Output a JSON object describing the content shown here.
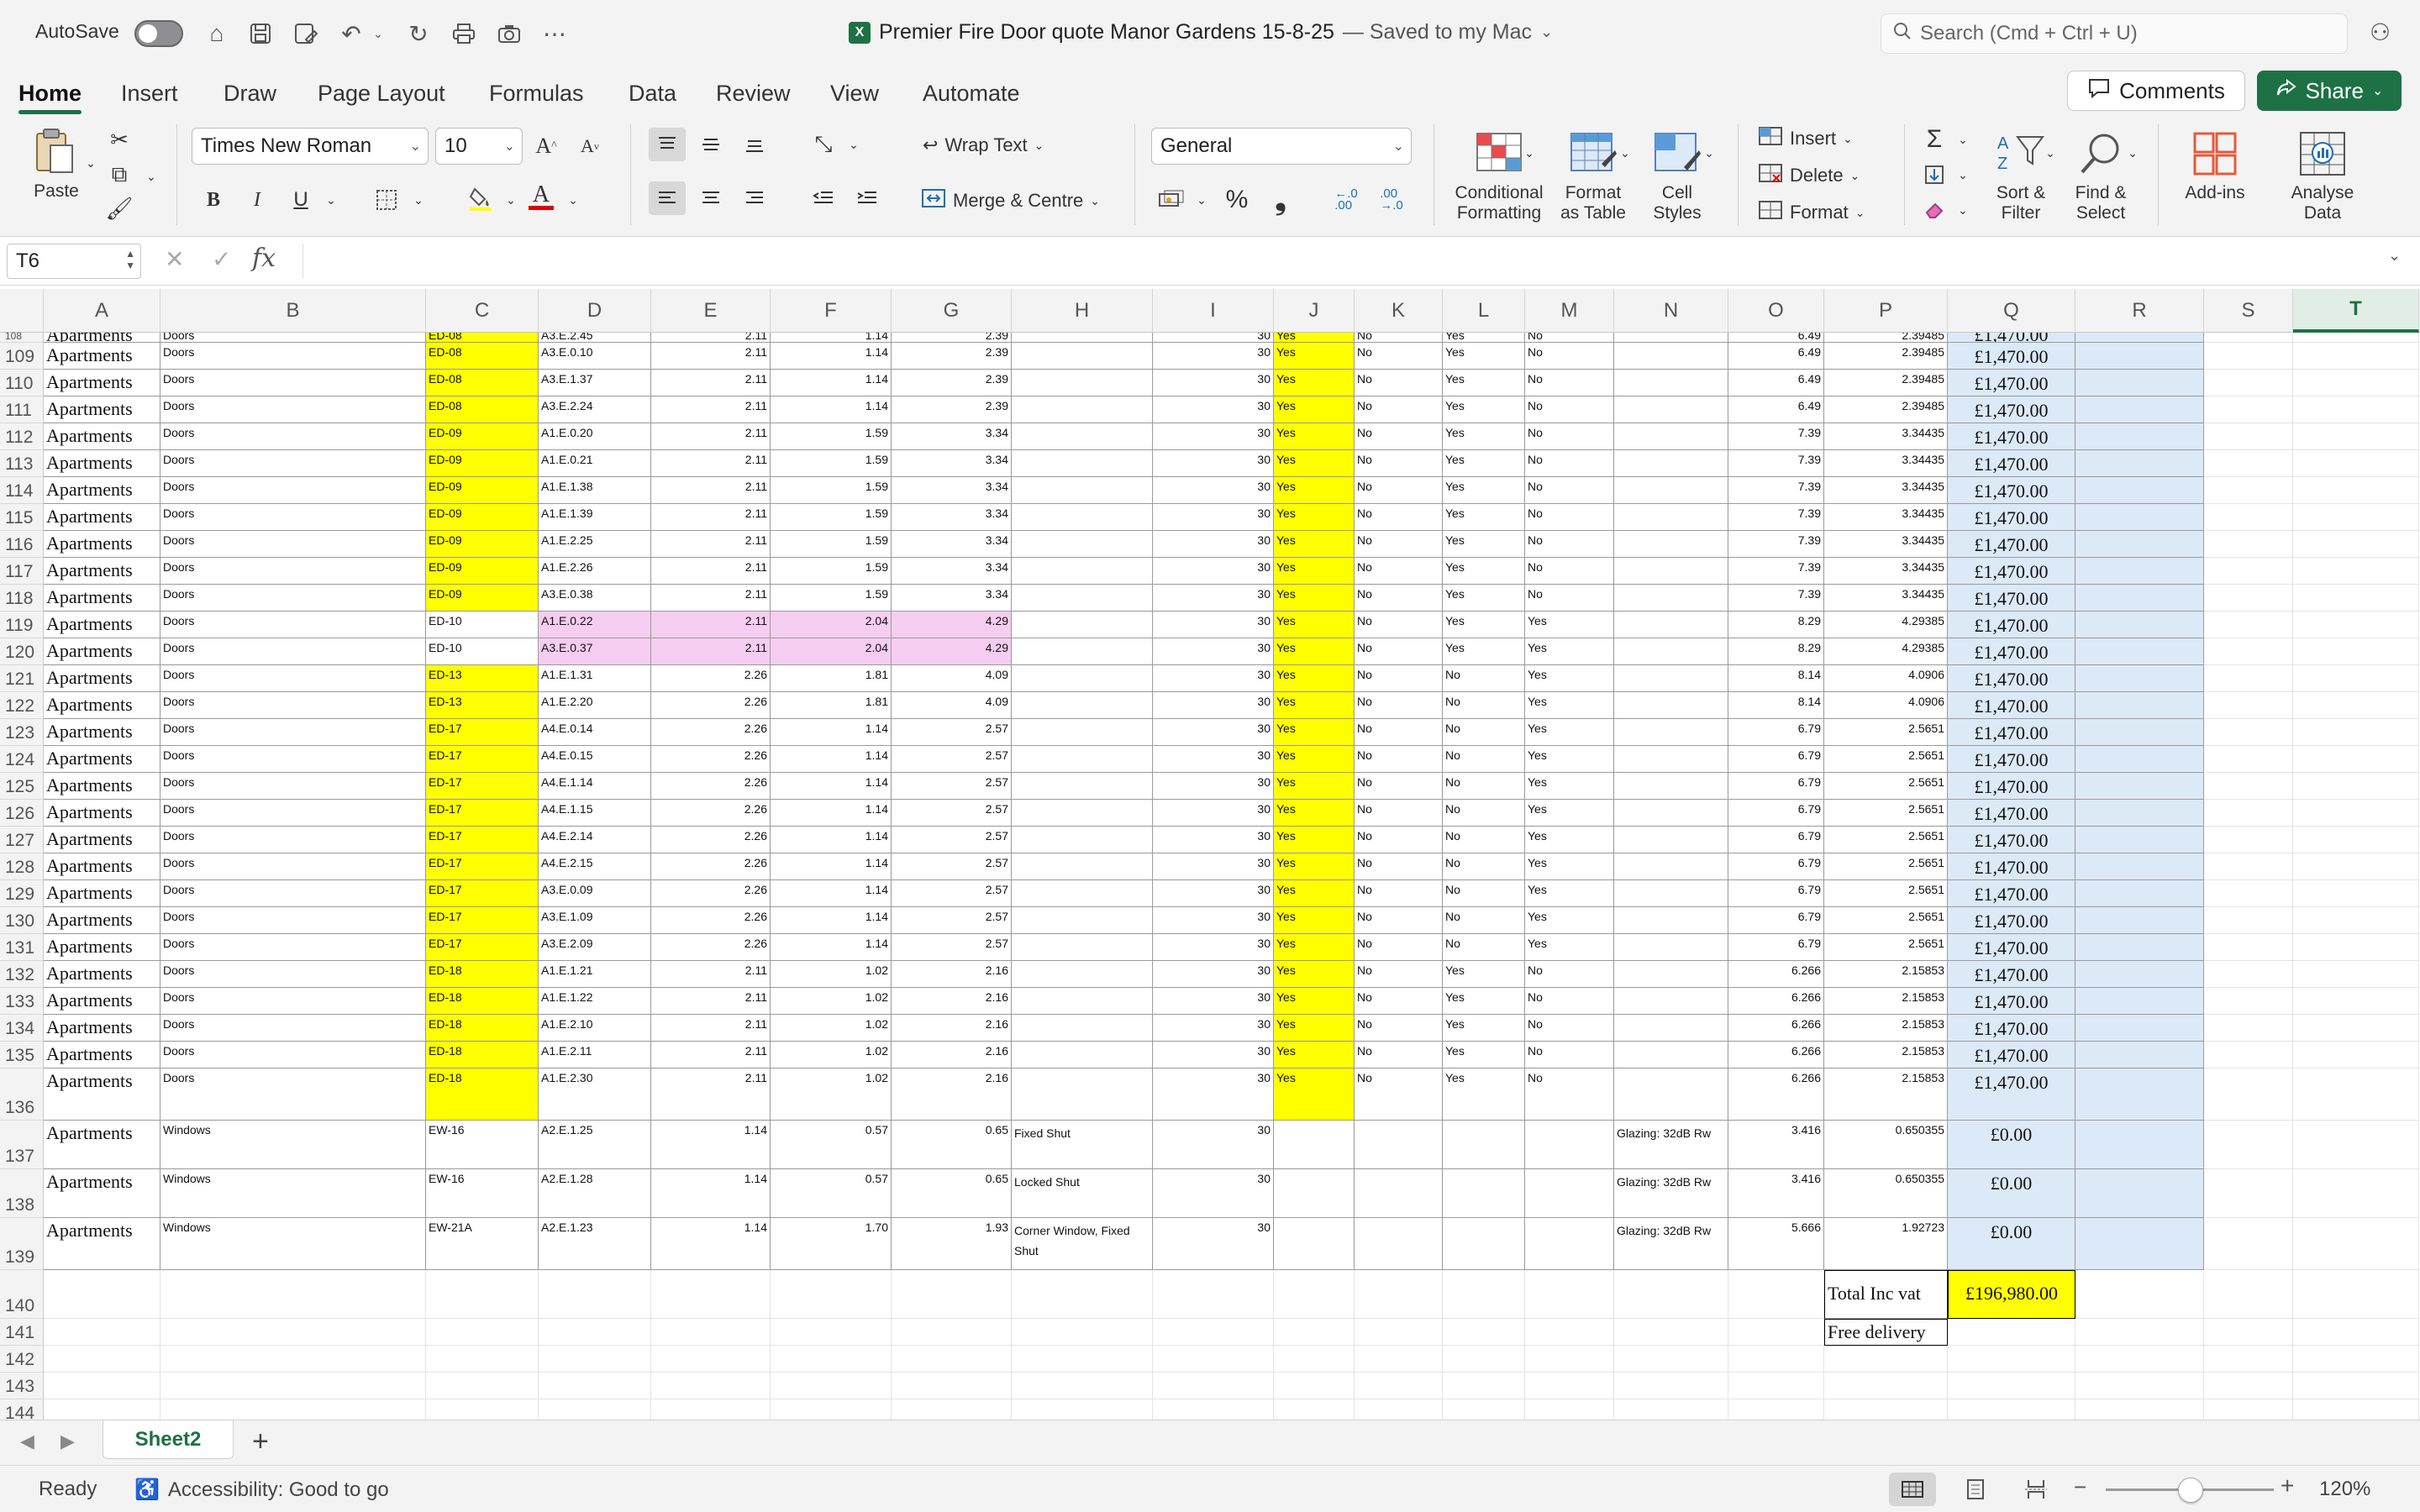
{
  "titlebar": {
    "autosave_label": "AutoSave",
    "doc_title": "Premier Fire Door quote  Manor Gardens 15-8-25",
    "doc_status": "— Saved to my Mac",
    "search_placeholder": "Search (Cmd + Ctrl + U)"
  },
  "ribbon_tabs": [
    "Home",
    "Insert",
    "Draw",
    "Page Layout",
    "Formulas",
    "Data",
    "Review",
    "View",
    "Automate"
  ],
  "buttons": {
    "comments": "Comments",
    "share": "Share"
  },
  "ribbon": {
    "paste": "Paste",
    "font_name": "Times New Roman",
    "font_size": "10",
    "wrap_text": "Wrap Text",
    "merge_centre": "Merge & Centre",
    "number_format": "General",
    "conditional_formatting": [
      "Conditional",
      "Formatting"
    ],
    "format_as_table": [
      "Format",
      "as Table"
    ],
    "cell_styles": [
      "Cell",
      "Styles"
    ],
    "insert": "Insert",
    "delete": "Delete",
    "format": "Format",
    "sort_filter": [
      "Sort &",
      "Filter"
    ],
    "find_select": [
      "Find &",
      "Select"
    ],
    "addins": "Add-ins",
    "analyse_data": [
      "Analyse",
      "Data"
    ],
    "bold": "B",
    "italic": "I",
    "underline": "U",
    "percent": "%",
    "comma": "❟",
    "increase_font": "A",
    "decrease_font": "A",
    "font_color": "A"
  },
  "formula_bar": {
    "name_box": "T6",
    "fx": "fx",
    "formula": ""
  },
  "columns": [
    "A",
    "B",
    "C",
    "D",
    "E",
    "F",
    "G",
    "H",
    "I",
    "J",
    "K",
    "L",
    "M",
    "N",
    "O",
    "P",
    "Q",
    "R",
    "S",
    "T"
  ],
  "selected_column": "T",
  "rows": [
    {
      "n": "108",
      "partial": true,
      "cells": [
        "Apartments",
        "Doors",
        "ED-08",
        "A3.E.2.45",
        "2.11",
        "1.14",
        "2.39",
        "",
        "30",
        "Yes",
        "No",
        "Yes",
        "No",
        "",
        "6.49",
        "2.39485",
        "£1,470.00",
        ""
      ]
    },
    {
      "n": "109",
      "cells": [
        "Apartments",
        "Doors",
        "ED-08",
        "A3.E.0.10",
        "2.11",
        "1.14",
        "2.39",
        "",
        "30",
        "Yes",
        "No",
        "Yes",
        "No",
        "",
        "6.49",
        "2.39485",
        "£1,470.00",
        ""
      ]
    },
    {
      "n": "110",
      "cells": [
        "Apartments",
        "Doors",
        "ED-08",
        "A3.E.1.37",
        "2.11",
        "1.14",
        "2.39",
        "",
        "30",
        "Yes",
        "No",
        "Yes",
        "No",
        "",
        "6.49",
        "2.39485",
        "£1,470.00",
        ""
      ]
    },
    {
      "n": "111",
      "cells": [
        "Apartments",
        "Doors",
        "ED-08",
        "A3.E.2.24",
        "2.11",
        "1.14",
        "2.39",
        "",
        "30",
        "Yes",
        "No",
        "Yes",
        "No",
        "",
        "6.49",
        "2.39485",
        "£1,470.00",
        ""
      ]
    },
    {
      "n": "112",
      "cells": [
        "Apartments",
        "Doors",
        "ED-09",
        "A1.E.0.20",
        "2.11",
        "1.59",
        "3.34",
        "",
        "30",
        "Yes",
        "No",
        "Yes",
        "No",
        "",
        "7.39",
        "3.34435",
        "£1,470.00",
        ""
      ]
    },
    {
      "n": "113",
      "cells": [
        "Apartments",
        "Doors",
        "ED-09",
        "A1.E.0.21",
        "2.11",
        "1.59",
        "3.34",
        "",
        "30",
        "Yes",
        "No",
        "Yes",
        "No",
        "",
        "7.39",
        "3.34435",
        "£1,470.00",
        ""
      ]
    },
    {
      "n": "114",
      "cells": [
        "Apartments",
        "Doors",
        "ED-09",
        "A1.E.1.38",
        "2.11",
        "1.59",
        "3.34",
        "",
        "30",
        "Yes",
        "No",
        "Yes",
        "No",
        "",
        "7.39",
        "3.34435",
        "£1,470.00",
        ""
      ]
    },
    {
      "n": "115",
      "cells": [
        "Apartments",
        "Doors",
        "ED-09",
        "A1.E.1.39",
        "2.11",
        "1.59",
        "3.34",
        "",
        "30",
        "Yes",
        "No",
        "Yes",
        "No",
        "",
        "7.39",
        "3.34435",
        "£1,470.00",
        ""
      ]
    },
    {
      "n": "116",
      "cells": [
        "Apartments",
        "Doors",
        "ED-09",
        "A1.E.2.25",
        "2.11",
        "1.59",
        "3.34",
        "",
        "30",
        "Yes",
        "No",
        "Yes",
        "No",
        "",
        "7.39",
        "3.34435",
        "£1,470.00",
        ""
      ]
    },
    {
      "n": "117",
      "cells": [
        "Apartments",
        "Doors",
        "ED-09",
        "A1.E.2.26",
        "2.11",
        "1.59",
        "3.34",
        "",
        "30",
        "Yes",
        "No",
        "Yes",
        "No",
        "",
        "7.39",
        "3.34435",
        "£1,470.00",
        ""
      ]
    },
    {
      "n": "118",
      "cells": [
        "Apartments",
        "Doors",
        "ED-09",
        "A3.E.0.38",
        "2.11",
        "1.59",
        "3.34",
        "",
        "30",
        "Yes",
        "No",
        "Yes",
        "No",
        "",
        "7.39",
        "3.34435",
        "£1,470.00",
        ""
      ]
    },
    {
      "n": "119",
      "pink": true,
      "cells": [
        "Apartments",
        "Doors",
        "ED-10",
        "A1.E.0.22",
        "2.11",
        "2.04",
        "4.29",
        "",
        "30",
        "Yes",
        "No",
        "Yes",
        "Yes",
        "",
        "8.29",
        "4.29385",
        "£1,470.00",
        ""
      ]
    },
    {
      "n": "120",
      "pink": true,
      "cells": [
        "Apartments",
        "Doors",
        "ED-10",
        "A3.E.0.37",
        "2.11",
        "2.04",
        "4.29",
        "",
        "30",
        "Yes",
        "No",
        "Yes",
        "Yes",
        "",
        "8.29",
        "4.29385",
        "£1,470.00",
        ""
      ]
    },
    {
      "n": "121",
      "cells": [
        "Apartments",
        "Doors",
        "ED-13",
        "A1.E.1.31",
        "2.26",
        "1.81",
        "4.09",
        "",
        "30",
        "Yes",
        "No",
        "No",
        "Yes",
        "",
        "8.14",
        "4.0906",
        "£1,470.00",
        ""
      ]
    },
    {
      "n": "122",
      "cells": [
        "Apartments",
        "Doors",
        "ED-13",
        "A1.E.2.20",
        "2.26",
        "1.81",
        "4.09",
        "",
        "30",
        "Yes",
        "No",
        "No",
        "Yes",
        "",
        "8.14",
        "4.0906",
        "£1,470.00",
        ""
      ]
    },
    {
      "n": "123",
      "cells": [
        "Apartments",
        "Doors",
        "ED-17",
        "A4.E.0.14",
        "2.26",
        "1.14",
        "2.57",
        "",
        "30",
        "Yes",
        "No",
        "No",
        "Yes",
        "",
        "6.79",
        "2.5651",
        "£1,470.00",
        ""
      ]
    },
    {
      "n": "124",
      "cells": [
        "Apartments",
        "Doors",
        "ED-17",
        "A4.E.0.15",
        "2.26",
        "1.14",
        "2.57",
        "",
        "30",
        "Yes",
        "No",
        "No",
        "Yes",
        "",
        "6.79",
        "2.5651",
        "£1,470.00",
        ""
      ]
    },
    {
      "n": "125",
      "cells": [
        "Apartments",
        "Doors",
        "ED-17",
        "A4.E.1.14",
        "2.26",
        "1.14",
        "2.57",
        "",
        "30",
        "Yes",
        "No",
        "No",
        "Yes",
        "",
        "6.79",
        "2.5651",
        "£1,470.00",
        ""
      ]
    },
    {
      "n": "126",
      "cells": [
        "Apartments",
        "Doors",
        "ED-17",
        "A4.E.1.15",
        "2.26",
        "1.14",
        "2.57",
        "",
        "30",
        "Yes",
        "No",
        "No",
        "Yes",
        "",
        "6.79",
        "2.5651",
        "£1,470.00",
        ""
      ]
    },
    {
      "n": "127",
      "cells": [
        "Apartments",
        "Doors",
        "ED-17",
        "A4.E.2.14",
        "2.26",
        "1.14",
        "2.57",
        "",
        "30",
        "Yes",
        "No",
        "No",
        "Yes",
        "",
        "6.79",
        "2.5651",
        "£1,470.00",
        ""
      ]
    },
    {
      "n": "128",
      "cells": [
        "Apartments",
        "Doors",
        "ED-17",
        "A4.E.2.15",
        "2.26",
        "1.14",
        "2.57",
        "",
        "30",
        "Yes",
        "No",
        "No",
        "Yes",
        "",
        "6.79",
        "2.5651",
        "£1,470.00",
        ""
      ]
    },
    {
      "n": "129",
      "cells": [
        "Apartments",
        "Doors",
        "ED-17",
        "A3.E.0.09",
        "2.26",
        "1.14",
        "2.57",
        "",
        "30",
        "Yes",
        "No",
        "No",
        "Yes",
        "",
        "6.79",
        "2.5651",
        "£1,470.00",
        ""
      ]
    },
    {
      "n": "130",
      "cells": [
        "Apartments",
        "Doors",
        "ED-17",
        "A3.E.1.09",
        "2.26",
        "1.14",
        "2.57",
        "",
        "30",
        "Yes",
        "No",
        "No",
        "Yes",
        "",
        "6.79",
        "2.5651",
        "£1,470.00",
        ""
      ]
    },
    {
      "n": "131",
      "cells": [
        "Apartments",
        "Doors",
        "ED-17",
        "A3.E.2.09",
        "2.26",
        "1.14",
        "2.57",
        "",
        "30",
        "Yes",
        "No",
        "No",
        "Yes",
        "",
        "6.79",
        "2.5651",
        "£1,470.00",
        ""
      ]
    },
    {
      "n": "132",
      "cells": [
        "Apartments",
        "Doors",
        "ED-18",
        "A1.E.1.21",
        "2.11",
        "1.02",
        "2.16",
        "",
        "30",
        "Yes",
        "No",
        "Yes",
        "No",
        "",
        "6.266",
        "2.15853",
        "£1,470.00",
        ""
      ]
    },
    {
      "n": "133",
      "cells": [
        "Apartments",
        "Doors",
        "ED-18",
        "A1.E.1.22",
        "2.11",
        "1.02",
        "2.16",
        "",
        "30",
        "Yes",
        "No",
        "Yes",
        "No",
        "",
        "6.266",
        "2.15853",
        "£1,470.00",
        ""
      ]
    },
    {
      "n": "134",
      "cells": [
        "Apartments",
        "Doors",
        "ED-18",
        "A1.E.2.10",
        "2.11",
        "1.02",
        "2.16",
        "",
        "30",
        "Yes",
        "No",
        "Yes",
        "No",
        "",
        "6.266",
        "2.15853",
        "£1,470.00",
        ""
      ]
    },
    {
      "n": "135",
      "cells": [
        "Apartments",
        "Doors",
        "ED-18",
        "A1.E.2.11",
        "2.11",
        "1.02",
        "2.16",
        "",
        "30",
        "Yes",
        "No",
        "Yes",
        "No",
        "",
        "6.266",
        "2.15853",
        "£1,470.00",
        ""
      ]
    },
    {
      "n": "136",
      "tall": true,
      "cells": [
        "Apartments",
        "Doors",
        "ED-18",
        "A1.E.2.30",
        "2.11",
        "1.02",
        "2.16",
        "",
        "30",
        "Yes",
        "No",
        "Yes",
        "No",
        "",
        "6.266",
        "2.15853",
        "£1,470.00",
        ""
      ]
    },
    {
      "n": "137",
      "tall": true,
      "window": true,
      "cells": [
        "Apartments",
        "Windows",
        "EW-16",
        "A2.E.1.25",
        "1.14",
        "0.57",
        "0.65",
        "Fixed Shut",
        "30",
        "",
        "",
        "",
        "",
        "Glazing: 32dB Rw",
        "3.416",
        "0.650355",
        "£0.00",
        ""
      ]
    },
    {
      "n": "138",
      "tall": true,
      "window": true,
      "cells": [
        "Apartments",
        "Windows",
        "EW-16",
        "A2.E.1.28",
        "1.14",
        "0.57",
        "0.65",
        "Locked Shut",
        "30",
        "",
        "",
        "",
        "",
        "Glazing: 32dB Rw",
        "3.416",
        "0.650355",
        "£0.00",
        ""
      ]
    },
    {
      "n": "139",
      "tall": true,
      "window": true,
      "cells": [
        "Apartments",
        "Windows",
        "EW-21A",
        "A2.E.1.23",
        "1.14",
        "1.70",
        "1.93",
        "Corner Window, Fixed Shut",
        "30",
        "",
        "",
        "",
        "",
        "Glazing: 32dB Rw",
        "5.666",
        "1.92723",
        "£0.00",
        ""
      ]
    }
  ],
  "totals": {
    "label": "Total Inc vat",
    "value": "£196,980.00",
    "delivery": "Free delivery"
  },
  "extra_rows": [
    "140",
    "141",
    "142",
    "143",
    "144"
  ],
  "sheet_tabs": {
    "active": "Sheet2"
  },
  "status": {
    "ready": "Ready",
    "accessibility": "Accessibility: Good to go",
    "zoom": "120%"
  },
  "colors": {
    "accent": "#1e7145",
    "yellow": "#ffff00",
    "pink": "#f5cdf0",
    "blue_fill": "#dce9f7"
  }
}
